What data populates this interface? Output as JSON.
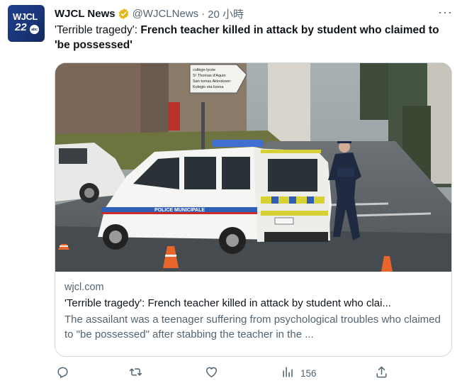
{
  "tweet": {
    "avatar": {
      "station": "WJCL",
      "channel": "22",
      "network": "abc"
    },
    "author_name": "WJCL News",
    "verified": true,
    "handle": "@WJCLNews",
    "separator": "·",
    "timestamp": "20 小時",
    "more_label": "···",
    "text_quote_start": "'Terrible tragedy': ",
    "text_bold": "French teacher killed in attack by student who claimed to 'be possessed'",
    "text_quote_end": ""
  },
  "card": {
    "photo_sign": {
      "lines": [
        "collège-lycée",
        "S¹ Thomas d'Aquin",
        "San tomas Akinokoen",
        "Kolegio eta lizeoa"
      ]
    },
    "photo_vehicle_text": "POLICE MUNICIPALE",
    "domain": "wjcl.com",
    "title": "'Terrible tragedy': French teacher killed in attack by student who clai...",
    "description": "The assailant was a teenager suffering from psychological troubles who claimed to \"be possessed\" after stabbing the teacher in the ..."
  },
  "actions": {
    "reply": {
      "icon": "reply-icon",
      "count": ""
    },
    "retweet": {
      "icon": "retweet-icon",
      "count": ""
    },
    "like": {
      "icon": "like-icon",
      "count": ""
    },
    "views": {
      "icon": "views-icon",
      "count": "156"
    },
    "share": {
      "icon": "share-icon",
      "count": ""
    }
  },
  "colors": {
    "verified_gold": "#e2b719",
    "text": "#0f1419",
    "secondary": "#536471",
    "border": "#cfd9de",
    "avatar_blue": "#1a3577"
  }
}
